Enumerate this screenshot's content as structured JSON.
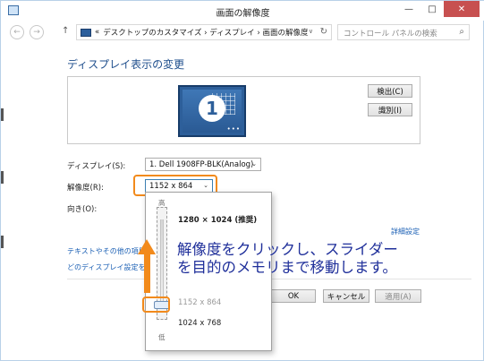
{
  "window": {
    "title": "画面の解像度",
    "minimize_glyph": "—",
    "maximize_glyph": "□",
    "close_glyph": "✕"
  },
  "nav": {
    "back_glyph": "←",
    "forward_glyph": "→",
    "up_glyph": "↑",
    "address_prefix": "«",
    "breadcrumb": "デスクトップのカスタマイズ › ディスプレイ › 画面の解像度",
    "address_dropdown_glyph": "∨",
    "refresh_glyph": "↻",
    "search_placeholder": "コントロール パネルの検索",
    "search_glyph": "⌕"
  },
  "main": {
    "heading": "ディスプレイ表示の変更",
    "monitor_number": "1",
    "monitor_dots": "•••",
    "detect_button": "検出(C)",
    "identify_button": "識別(I)",
    "display_label": "ディスプレイ(S):",
    "display_value": "1. Dell 1908FP-BLK(Analog)",
    "resolution_label": "解像度(R):",
    "resolution_value": "1152 x 864",
    "orientation_label": "向き(O):",
    "advanced_link": "詳細設定",
    "link1": "テキストやその他の項目",
    "link2": "どのディスプレイ設定を選",
    "ok_button": "OK",
    "cancel_button": "キャンセル",
    "apply_button": "適用(A)",
    "combo_arrow_glyph": "⌄"
  },
  "resolution_dropdown": {
    "high_label": "高",
    "low_label": "低",
    "option_top": "1280 × 1024 (推奨)",
    "option_mid": "1152 x 864",
    "option_bottom": "1024 x 768",
    "slider_level_fraction": 0.2
  },
  "annotation": {
    "line1": "解像度をクリックし、スライダー",
    "line2": "を目的のメモリまで移動します。",
    "color": "#f28a1b"
  }
}
